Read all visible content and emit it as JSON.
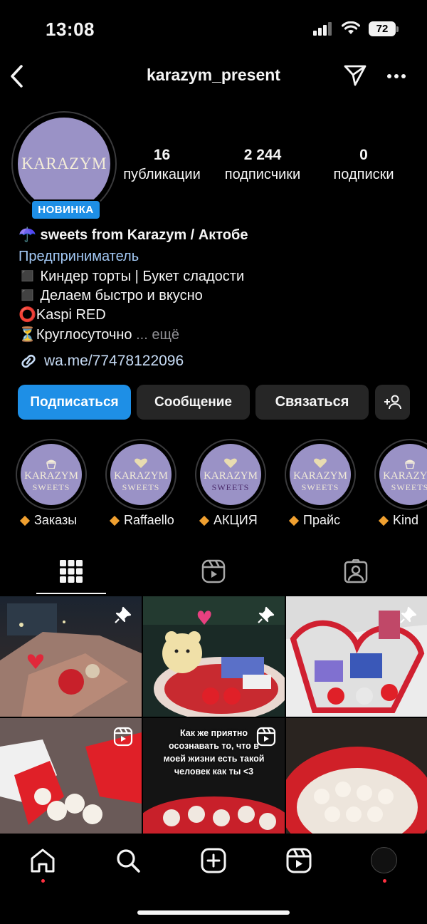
{
  "status_bar": {
    "time": "13:08",
    "battery": "72"
  },
  "header": {
    "username": "karazym_present"
  },
  "profile": {
    "avatar_text": "KARAZYM",
    "badge": "НОВИНКА",
    "stats": [
      {
        "value": "16",
        "label": "публикации"
      },
      {
        "value": "2 244",
        "label": "подписчики"
      },
      {
        "value": "0",
        "label": "подписки"
      }
    ]
  },
  "bio": {
    "name": "☂️ sweets from Karazym / Актобе",
    "category": "Предприниматель",
    "lines": [
      "◼️ Киндер торты | Букет сладости",
      "◼️  Делаем быстро и вкусно",
      "⭕Kaspi RED",
      "⏳Круглосуточно"
    ],
    "more": "... ещё",
    "link": "wa.me/77478122096"
  },
  "buttons": {
    "follow": "Подписаться",
    "message": "Сообщение",
    "contact": "Связаться"
  },
  "highlights": [
    {
      "label": "Заказы",
      "top_icon": "cupcake-icon",
      "line1": "KARAZYM",
      "line2": "SWEETS"
    },
    {
      "label": "Raffaello",
      "top_icon": "heart-icon",
      "line1": "KARAZYM",
      "line2": "SWEETS"
    },
    {
      "label": "АКЦИЯ",
      "top_icon": "heart-icon",
      "line1": "KARAZYM",
      "line2": "SWEETS"
    },
    {
      "label": "Прайс",
      "top_icon": "heart-icon",
      "line1": "KARAZYM",
      "line2": "SWEETS"
    },
    {
      "label": "Kind",
      "top_icon": "cupcake-icon",
      "line1": "KARAZYM",
      "line2": "SWEETS"
    }
  ],
  "grid": {
    "reel_caption": "Как же приятно осознавать то, что в моей жизни есть такой человек как ты <3"
  },
  "colors": {
    "accent": "#1e8fe6",
    "background": "#000000",
    "button_dark": "#262626",
    "brand_purple": "#9a92c6",
    "notification_dot": "#ff3040"
  }
}
